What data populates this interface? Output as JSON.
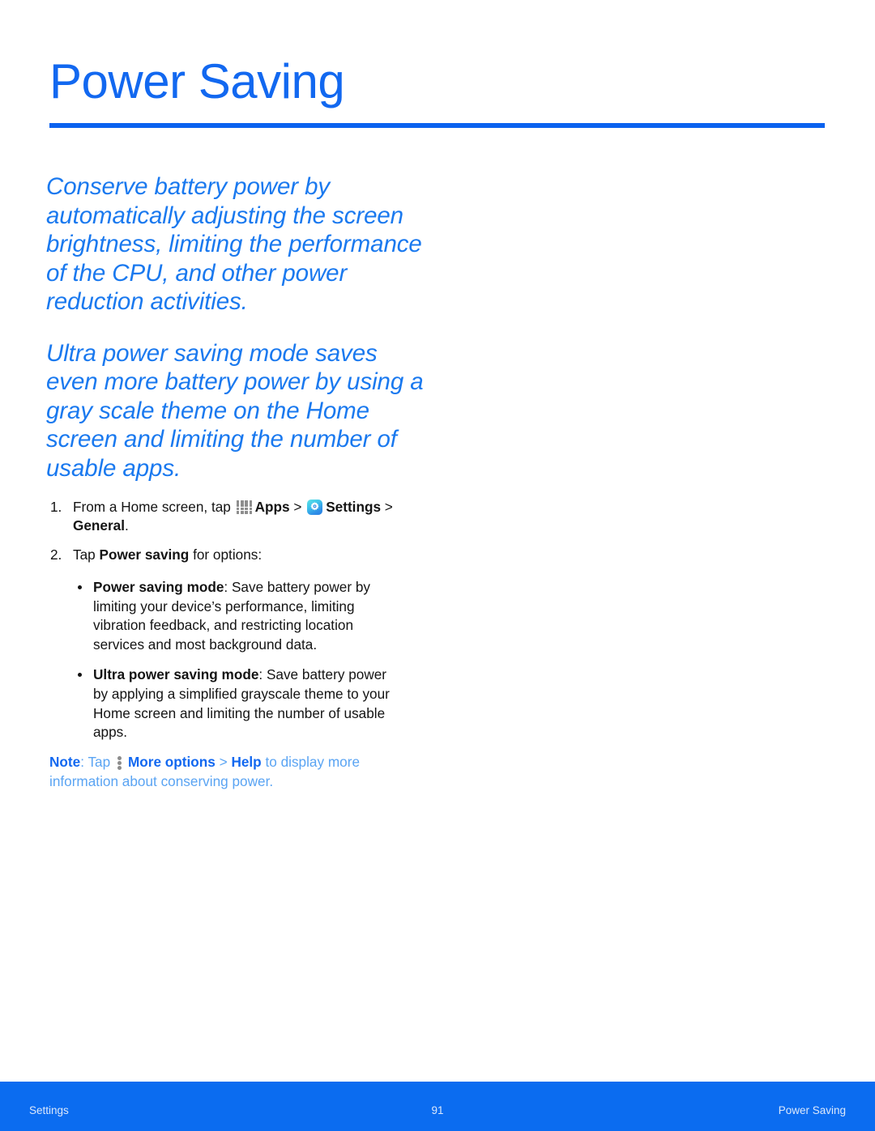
{
  "document": {
    "title": "Power Saving",
    "accent_color": "#1268f0",
    "rule_color": "#0b62ef",
    "body_color": "#141414"
  },
  "intro": {
    "paragraph_1": "Conserve battery power by automatically adjusting the screen brightness, limiting the performance of the CPU, and other power reduction activities.",
    "paragraph_2": "Ultra power saving mode saves even more battery power by using a gray scale theme on the Home screen and limiting the number of usable apps."
  },
  "steps": [
    {
      "number": "1.",
      "text_before_apps_icon": "From a Home screen, tap ",
      "apps_label": "Apps",
      "separator_1": " > ",
      "settings_label": "Settings",
      "separator_2": " > ",
      "general_label": "General",
      "period": ".",
      "apps_icon": "apps-grid-icon",
      "settings_icon": "settings-gear-icon"
    },
    {
      "number": "2.",
      "text_before": "Tap ",
      "bold_label": "Power saving",
      "text_after": " for options:"
    }
  ],
  "bullets": [
    {
      "term": "Power saving mode",
      "description": ": Save battery power by limiting your device’s performance, limiting vibration feedback, and restricting location services and most background data."
    },
    {
      "term": "Ultra power saving mode",
      "description": ": Save battery power by applying a simplified grayscale theme to your Home screen and limiting the number of usable apps."
    }
  ],
  "note": {
    "label": "Note",
    "after_label": ": Tap ",
    "more_options_icon": "more-options-kebab-icon",
    "more_options_label": "More options",
    "separator": " > ",
    "help_label": "Help",
    "tail": " to display more information about conserving power.",
    "color": "#4e9cf2"
  },
  "footer": {
    "left": "Settings",
    "center": "91",
    "right": "Power Saving",
    "background_color": "#0b6cf0",
    "text_color": "#dbe8fb"
  }
}
